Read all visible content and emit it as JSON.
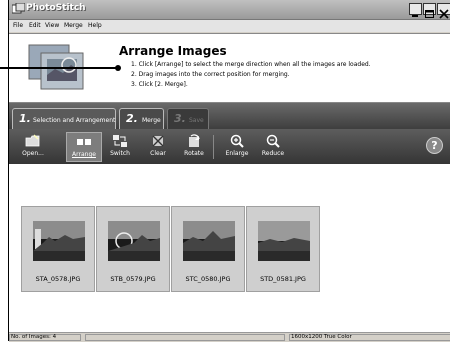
{
  "window": {
    "title": "PhotoStitch",
    "menu": [
      "File",
      "Edit",
      "View",
      "Merge",
      "Help"
    ]
  },
  "header": {
    "title": "Arrange Images",
    "steps": [
      "1. Click [Arrange] to select the merge direction when all the images are loaded.",
      "2. Drag images into the correct position for merging.",
      "3. Click [2. Merge]."
    ]
  },
  "tabs": [
    {
      "num": "1.",
      "label": "Selection and Arrangement"
    },
    {
      "num": "2.",
      "label": "Merge"
    },
    {
      "num": "3.",
      "label": "Save"
    }
  ],
  "toolbar": {
    "items": [
      "Open...",
      "Arrange",
      "Switch",
      "Clear",
      "Rotate",
      "Enlarge",
      "Reduce"
    ],
    "help": "?"
  },
  "images": [
    {
      "filename": "STA_0578.JPG"
    },
    {
      "filename": "STB_0579.JPG"
    },
    {
      "filename": "STC_0580.JPG"
    },
    {
      "filename": "STD_0581.JPG"
    }
  ],
  "status": {
    "count": "No. of Images: 4",
    "resolution": "1600x1200 True Color"
  },
  "icons": {
    "app": "photostitch-icon",
    "minimize": "minimize-icon",
    "maximize": "maximize-icon",
    "close": "close-icon"
  }
}
